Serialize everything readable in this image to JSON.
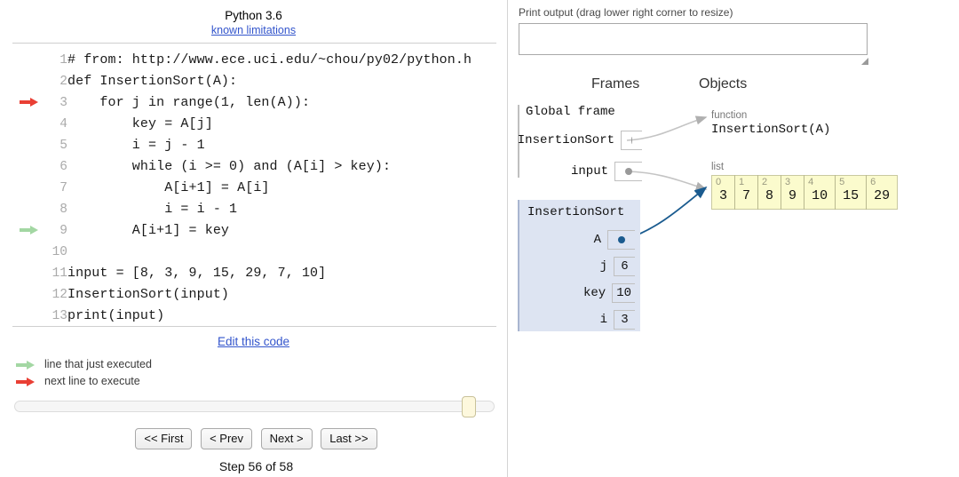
{
  "header": {
    "python_version": "Python 3.6",
    "known_limitations_link": "known limitations"
  },
  "code": {
    "lines": [
      {
        "num": "1",
        "text": "# from: http://www.ece.uci.edu/~chou/py02/python.h",
        "marker": ""
      },
      {
        "num": "2",
        "text": "def InsertionSort(A):",
        "marker": ""
      },
      {
        "num": "3",
        "text": "    for j in range(1, len(A)):",
        "marker": "next"
      },
      {
        "num": "4",
        "text": "        key = A[j]",
        "marker": ""
      },
      {
        "num": "5",
        "text": "        i = j - 1",
        "marker": ""
      },
      {
        "num": "6",
        "text": "        while (i >= 0) and (A[i] > key):",
        "marker": ""
      },
      {
        "num": "7",
        "text": "            A[i+1] = A[i]",
        "marker": ""
      },
      {
        "num": "8",
        "text": "            i = i - 1",
        "marker": ""
      },
      {
        "num": "9",
        "text": "        A[i+1] = key",
        "marker": "executed"
      },
      {
        "num": "10",
        "text": "",
        "marker": ""
      },
      {
        "num": "11",
        "text": "input = [8, 3, 9, 15, 29, 7, 10]",
        "marker": ""
      },
      {
        "num": "12",
        "text": "InsertionSort(input)",
        "marker": ""
      },
      {
        "num": "13",
        "text": "print(input)",
        "marker": ""
      }
    ]
  },
  "edit_code_link": "Edit this code",
  "legend": {
    "executed": "line that just executed",
    "next": "next line to execute"
  },
  "controls": {
    "first": "<< First",
    "prev": "< Prev",
    "next": "Next >",
    "last": "Last >>",
    "step_label": "Step 56 of 58",
    "slider_position_percent": 95
  },
  "visualization": {
    "print_output_label": "Print output (drag lower right corner to resize)",
    "print_output_value": "",
    "frames_heading": "Frames",
    "objects_heading": "Objects",
    "global_frame": {
      "title": "Global frame",
      "vars": [
        {
          "name": "InsertionSort",
          "value": "",
          "is_pointer": true
        },
        {
          "name": "input",
          "value": "",
          "is_pointer": true
        }
      ]
    },
    "call_frame": {
      "title": "InsertionSort",
      "vars": [
        {
          "name": "A",
          "value": "",
          "is_pointer": true
        },
        {
          "name": "j",
          "value": "6",
          "is_pointer": false
        },
        {
          "name": "key",
          "value": "10",
          "is_pointer": false
        },
        {
          "name": "i",
          "value": "3",
          "is_pointer": false
        }
      ]
    },
    "objects": [
      {
        "kind": "function",
        "type_label": "function",
        "body": "InsertionSort(A)"
      },
      {
        "kind": "list",
        "type_label": "list",
        "indices": [
          "0",
          "1",
          "2",
          "3",
          "4",
          "5",
          "6"
        ],
        "values": [
          "3",
          "7",
          "8",
          "9",
          "10",
          "15",
          "29"
        ]
      }
    ]
  },
  "colors": {
    "next_arrow": "#e93f34",
    "executed_arrow": "#a3d7a3",
    "link": "#3355cc",
    "frame_bg": "#dde4f2",
    "list_bg": "#fbfbcd",
    "pointer_blue": "#1a5b8f",
    "pointer_gray": "#999999"
  }
}
